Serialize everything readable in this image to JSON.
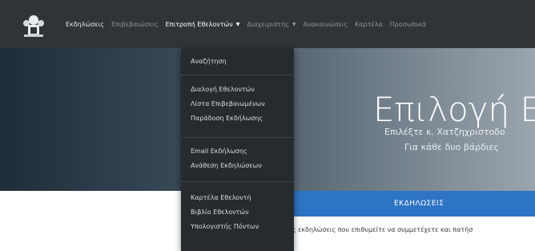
{
  "navbar": {
    "items": [
      {
        "label": "Εκδηλώσεις"
      },
      {
        "label": "Επιβεβαιώσεις"
      },
      {
        "label": "Επιτροπή Εθελοντών"
      },
      {
        "label": "Διαχειριστής"
      },
      {
        "label": "Ανακοινώσεις"
      },
      {
        "label": "Καρτέλα"
      },
      {
        "label": "Προσωπικά"
      }
    ]
  },
  "dropdown": {
    "items": [
      {
        "label": "Αναζήτηση"
      },
      {
        "label": "Διαλογή Εθελοντών"
      },
      {
        "label": "Λίστα Επιβεβαιωμένων"
      },
      {
        "label": "Παράδοση Εκδήλωσης"
      },
      {
        "label": "Email Εκδήλωσης"
      },
      {
        "label": "Ανάθεση Εκδηλώσεων"
      },
      {
        "label": "Καρτέλα Εθελοντή"
      },
      {
        "label": "Βιβλίο Εθελοντών"
      },
      {
        "label": "Υπολογιστής Πόντων"
      }
    ]
  },
  "hero": {
    "title": "Επιλογή Εκ",
    "subtitle_line1": "Επιλέξτε κ. Χατζηχριστοδο",
    "subtitle_line2": "Για κάθε δυο βάρδιες"
  },
  "tab": {
    "label": "ΕΚΔΗΛΩΣΕΙΣ"
  },
  "body": {
    "text": "ις εκδηλώσεις που επιθυμείτε να συμμετέχετε και πατήσ"
  },
  "colors": {
    "navbar_bg": "#2f3438",
    "dropdown_bg": "#262b2f",
    "tab_accent": "#2d74c4"
  }
}
